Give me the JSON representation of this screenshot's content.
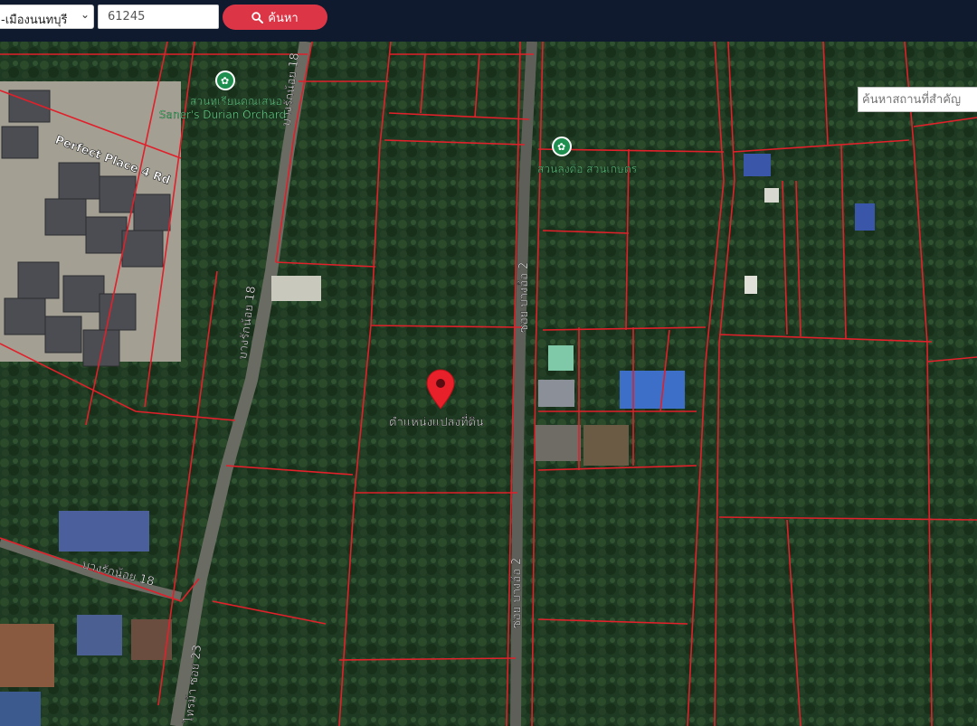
{
  "toolbar": {
    "district_value": "-เมืองนนทบุรี",
    "parcel_number": "61245",
    "search_label": "ค้นหา"
  },
  "map": {
    "place_search_placeholder": "ค้นหาสถานที่สำคัญ",
    "marker_label": "ตำแหน่งแปลงที่ดิน",
    "poi": [
      {
        "name_th": "สวนทุเรียนคุณเสนอ",
        "name_en": "Saner's Durian Orchard",
        "icon": "park-poi-icon"
      },
      {
        "name_th": "สวนลุงต้อ สวนเกษตร",
        "icon": "park-poi-icon"
      }
    ],
    "roads": {
      "perfect_place": "Perfect Place 4 Rd",
      "bang_rak_noi_18": "บางรักน้อย 18",
      "soi_bang_o_2": "ซอย บางอ้อ 2",
      "soi_23": "ไทรม้า ซอย 23"
    },
    "colors": {
      "parcel_line": "#e0202a",
      "marker": "#e8202a"
    }
  }
}
